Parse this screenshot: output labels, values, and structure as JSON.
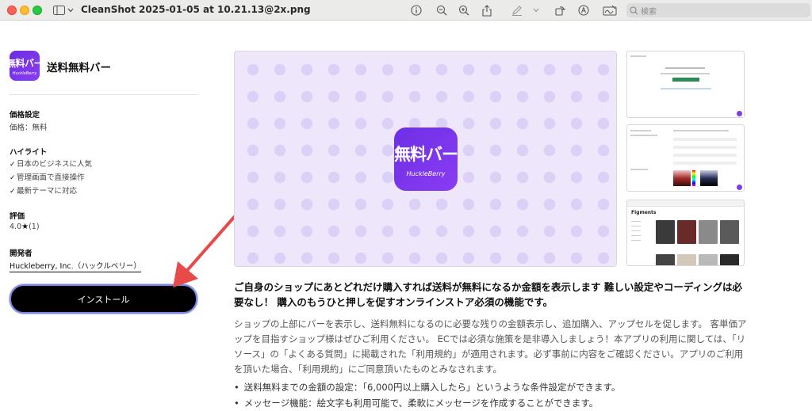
{
  "titlebar": {
    "filename": "CleanShot 2025-01-05 at 10.21.13@2x.png",
    "search_placeholder": "検索"
  },
  "app": {
    "icon_text": "無料バー",
    "icon_subtext": "HuckleBerry",
    "name": "送料無料バー"
  },
  "sidebar": {
    "pricing_heading": "価格設定",
    "pricing_value": "価格：無料",
    "highlights_heading": "ハイライト",
    "highlights": [
      "日本のビジネスに人気",
      "管理画面で直接操作",
      "最新テーマに対応"
    ],
    "rating_heading": "評価",
    "rating_value": "4.0",
    "rating_count": "(1)",
    "developer_heading": "開発者",
    "developer_name": "Huckleberry, Inc.（ハックルベリー）",
    "install_label": "インストール"
  },
  "hero": {
    "icon_text": "無料バー",
    "icon_subtext": "HuckleBerry"
  },
  "thumbnails": {
    "thumb3_title": "Figments"
  },
  "description": {
    "headline": "ご自身のショップにあとどれだけ購入すれば送料が無料になるか金額を表示します 難しい設定やコーディングは必要なし！ 購入のもうひと押しを促すオンラインストア必須の機能です。",
    "body": "ショップの上部にバーを表示し、送料無料になるのに必要な残りの金額表示し、追加購入、アップセルを促します。 客単価アップを目指すショップ様はぜひご利用ください。 ECでは必須な施策を是非導入しましょう！本アプリの利用に関しては、「リソース」の「よくある質問」に掲載された「利用規約」が適用されます。必ず事前に内容をご確認ください。アプリのご利用を頂いた場合、「利用規約」にご同意頂いたものとみなされます。",
    "bullets": [
      "送料無料までの金額の設定：「6,000円以上購入したら」というような条件設定ができます。",
      "メッセージ機能：絵文字も利用可能で、柔軟にメッセージを作成することができます。"
    ]
  },
  "colors": {
    "brand_purple": "#7b3ff0",
    "install_bg": "#000000",
    "arrow": "#e84a4a"
  }
}
